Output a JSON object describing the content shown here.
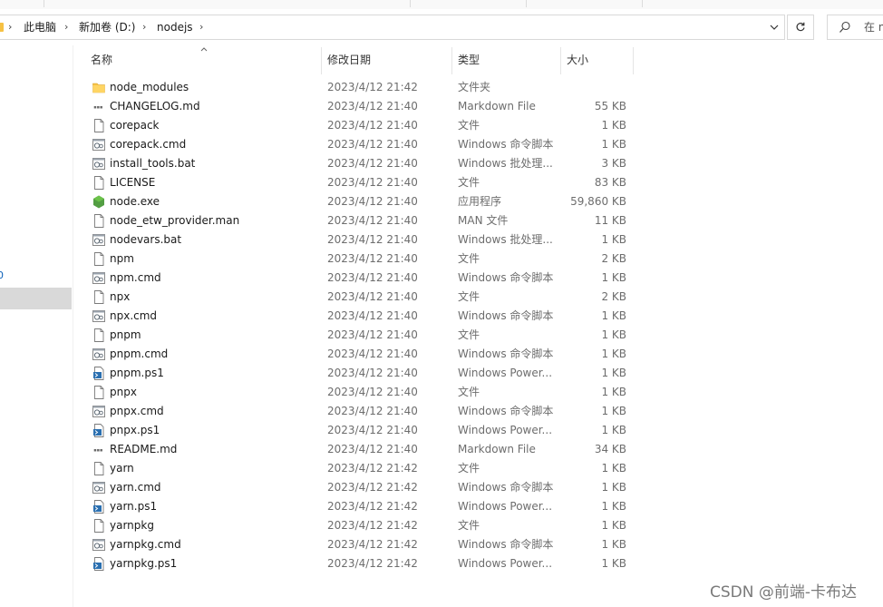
{
  "address": {
    "crumbs": [
      "此电脑",
      "新加卷 (D:)",
      "nodejs"
    ]
  },
  "search": {
    "placeholder": "在 n"
  },
  "columns": {
    "name": "名称",
    "date": "修改日期",
    "type": "类型",
    "size": "大小"
  },
  "files": [
    {
      "name": "node_modules",
      "date": "2023/4/12 21:42",
      "type": "文件夹",
      "size": "",
      "icon": "folder-icon"
    },
    {
      "name": "CHANGELOG.md",
      "date": "2023/4/12 21:40",
      "type": "Markdown File",
      "size": "55 KB",
      "icon": "markdown-file-icon"
    },
    {
      "name": "corepack",
      "date": "2023/4/12 21:40",
      "type": "文件",
      "size": "1 KB",
      "icon": "file-icon"
    },
    {
      "name": "corepack.cmd",
      "date": "2023/4/12 21:40",
      "type": "Windows 命令脚本",
      "size": "1 KB",
      "icon": "script-file-icon"
    },
    {
      "name": "install_tools.bat",
      "date": "2023/4/12 21:40",
      "type": "Windows 批处理...",
      "size": "3 KB",
      "icon": "script-file-icon"
    },
    {
      "name": "LICENSE",
      "date": "2023/4/12 21:40",
      "type": "文件",
      "size": "83 KB",
      "icon": "file-icon"
    },
    {
      "name": "node.exe",
      "date": "2023/4/12 21:40",
      "type": "应用程序",
      "size": "59,860 KB",
      "icon": "node-exe-icon"
    },
    {
      "name": "node_etw_provider.man",
      "date": "2023/4/12 21:40",
      "type": "MAN 文件",
      "size": "11 KB",
      "icon": "file-icon"
    },
    {
      "name": "nodevars.bat",
      "date": "2023/4/12 21:40",
      "type": "Windows 批处理...",
      "size": "1 KB",
      "icon": "script-file-icon"
    },
    {
      "name": "npm",
      "date": "2023/4/12 21:40",
      "type": "文件",
      "size": "2 KB",
      "icon": "file-icon"
    },
    {
      "name": "npm.cmd",
      "date": "2023/4/12 21:40",
      "type": "Windows 命令脚本",
      "size": "1 KB",
      "icon": "script-file-icon"
    },
    {
      "name": "npx",
      "date": "2023/4/12 21:40",
      "type": "文件",
      "size": "2 KB",
      "icon": "file-icon"
    },
    {
      "name": "npx.cmd",
      "date": "2023/4/12 21:40",
      "type": "Windows 命令脚本",
      "size": "1 KB",
      "icon": "script-file-icon"
    },
    {
      "name": "pnpm",
      "date": "2023/4/12 21:40",
      "type": "文件",
      "size": "1 KB",
      "icon": "file-icon"
    },
    {
      "name": "pnpm.cmd",
      "date": "2023/4/12 21:40",
      "type": "Windows 命令脚本",
      "size": "1 KB",
      "icon": "script-file-icon"
    },
    {
      "name": "pnpm.ps1",
      "date": "2023/4/12 21:40",
      "type": "Windows Power...",
      "size": "1 KB",
      "icon": "powershell-file-icon"
    },
    {
      "name": "pnpx",
      "date": "2023/4/12 21:40",
      "type": "文件",
      "size": "1 KB",
      "icon": "file-icon"
    },
    {
      "name": "pnpx.cmd",
      "date": "2023/4/12 21:40",
      "type": "Windows 命令脚本",
      "size": "1 KB",
      "icon": "script-file-icon"
    },
    {
      "name": "pnpx.ps1",
      "date": "2023/4/12 21:40",
      "type": "Windows Power...",
      "size": "1 KB",
      "icon": "powershell-file-icon"
    },
    {
      "name": "README.md",
      "date": "2023/4/12 21:40",
      "type": "Markdown File",
      "size": "34 KB",
      "icon": "markdown-file-icon"
    },
    {
      "name": "yarn",
      "date": "2023/4/12 21:42",
      "type": "文件",
      "size": "1 KB",
      "icon": "file-icon"
    },
    {
      "name": "yarn.cmd",
      "date": "2023/4/12 21:42",
      "type": "Windows 命令脚本",
      "size": "1 KB",
      "icon": "script-file-icon"
    },
    {
      "name": "yarn.ps1",
      "date": "2023/4/12 21:42",
      "type": "Windows Power...",
      "size": "1 KB",
      "icon": "powershell-file-icon"
    },
    {
      "name": "yarnpkg",
      "date": "2023/4/12 21:42",
      "type": "文件",
      "size": "1 KB",
      "icon": "file-icon"
    },
    {
      "name": "yarnpkg.cmd",
      "date": "2023/4/12 21:42",
      "type": "Windows 命令脚本",
      "size": "1 KB",
      "icon": "script-file-icon"
    },
    {
      "name": "yarnpkg.ps1",
      "date": "2023/4/12 21:42",
      "type": "Windows Power...",
      "size": "1 KB",
      "icon": "powershell-file-icon"
    }
  ],
  "watermark": "CSDN @前端-卡布达",
  "colors": {
    "folder": "#f6c143",
    "node_green": "#539e43",
    "powershell_blue": "#2a6fb0",
    "selection": "#d9d9d9"
  }
}
